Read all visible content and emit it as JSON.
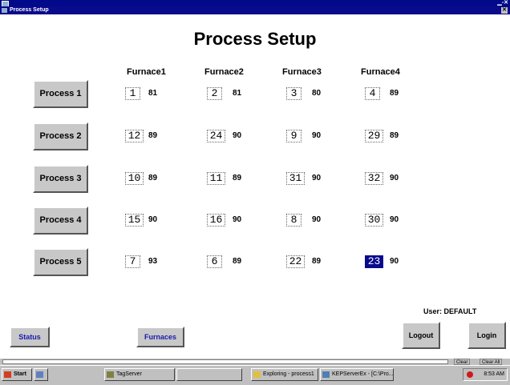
{
  "window": {
    "title": "Process Setup"
  },
  "page": {
    "title": "Process Setup"
  },
  "columns": [
    "Furnace1",
    "Furnace2",
    "Furnace3",
    "Furnace4"
  ],
  "processes": [
    {
      "label": "Process 1",
      "cells": [
        {
          "box": "1",
          "val": "81"
        },
        {
          "box": "2",
          "val": "81"
        },
        {
          "box": "3",
          "val": "80"
        },
        {
          "box": "4",
          "val": "89"
        }
      ]
    },
    {
      "label": "Process 2",
      "cells": [
        {
          "box": "12",
          "val": "89"
        },
        {
          "box": "24",
          "val": "90"
        },
        {
          "box": "9",
          "val": "90"
        },
        {
          "box": "29",
          "val": "89"
        }
      ]
    },
    {
      "label": "Process 3",
      "cells": [
        {
          "box": "10",
          "val": "89"
        },
        {
          "box": "11",
          "val": "89"
        },
        {
          "box": "31",
          "val": "90"
        },
        {
          "box": "32",
          "val": "90"
        }
      ]
    },
    {
      "label": "Process 4",
      "cells": [
        {
          "box": "15",
          "val": "90"
        },
        {
          "box": "16",
          "val": "90"
        },
        {
          "box": "8",
          "val": "90"
        },
        {
          "box": "30",
          "val": "90"
        }
      ]
    },
    {
      "label": "Process 5",
      "cells": [
        {
          "box": "7",
          "val": "93"
        },
        {
          "box": "6",
          "val": "89"
        },
        {
          "box": "22",
          "val": "89"
        },
        {
          "box": "23",
          "val": "90"
        }
      ]
    }
  ],
  "user": {
    "label": "User: DEFAULT"
  },
  "buttons": {
    "status": "Status",
    "furnaces": "Furnaces",
    "logout": "Logout",
    "login": "Login"
  },
  "strip": {
    "clear": "Clear",
    "clear_all": "Clear All"
  },
  "taskbar": {
    "start": "Start",
    "items": [
      "TagServer",
      "",
      "Exploring - process1",
      "KEPServerEx - [C:\\Pro..."
    ],
    "clock": "8:53 AM"
  },
  "colors": {
    "titlebar": "#0a0a8c",
    "selected": "#0a0a8c",
    "button_face": "#c8c8c8",
    "button_text_blue": "#1a1ab0"
  }
}
